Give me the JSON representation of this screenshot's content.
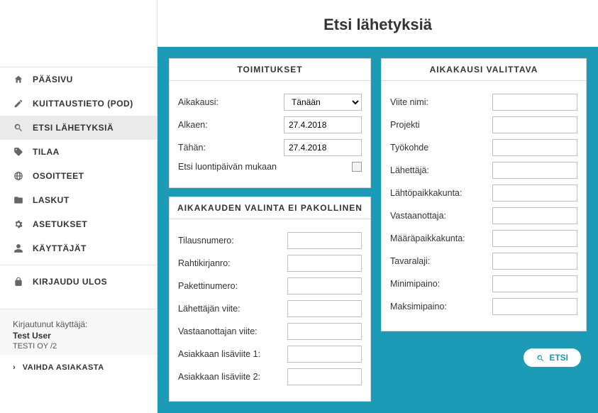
{
  "page": {
    "title": "Etsi lähetyksiä"
  },
  "nav": {
    "items": [
      {
        "label": "PÄÄSIVU",
        "icon": "home-icon"
      },
      {
        "label": "KUITTAUSTIETO (POD)",
        "icon": "pencil-icon"
      },
      {
        "label": "ETSI LÄHETYKSIÄ",
        "icon": "search-icon",
        "active": true
      },
      {
        "label": "TILAA",
        "icon": "tag-icon"
      },
      {
        "label": "OSOITTEET",
        "icon": "globe-icon"
      },
      {
        "label": "LASKUT",
        "icon": "folder-icon"
      },
      {
        "label": "ASETUKSET",
        "icon": "gear-icon"
      },
      {
        "label": "KÄYTTÄJÄT",
        "icon": "user-icon"
      }
    ],
    "logout": {
      "label": "KIRJAUDU ULOS",
      "icon": "lock-icon"
    }
  },
  "user": {
    "logged_in_label": "Kirjautunut käyttäjä:",
    "name": "Test User",
    "company": "TESTI OY /2",
    "change_customer": "VAIHDA ASIAKASTA"
  },
  "cards": {
    "toimitukset": {
      "header": "TOIMITUKSET",
      "aikakausi_label": "Aikakausi:",
      "aikakausi_value": "Tänään",
      "alkaen_label": "Alkaen:",
      "alkaen_value": "27.4.2018",
      "tahan_label": "Tähän:",
      "tahan_value": "27.4.2018",
      "luontipaiva_label": "Etsi luontipäivän mukaan"
    },
    "optional": {
      "header": "AIKAKAUDEN VALINTA EI PAKOLLINEN",
      "tilausnumero": "Tilausnumero:",
      "rahtikirjanro": "Rahtikirjanro:",
      "pakettinumero": "Pakettinumero:",
      "lahettajan_viite": "Lähettäjän viite:",
      "vastaanottajan_viite": "Vastaanottajan viite:",
      "lisaviite1": "Asiakkaan lisäviite 1:",
      "lisaviite2": "Asiakkaan lisäviite 2:"
    },
    "aikakausi": {
      "header": "AIKAKAUSI VALITTAVA",
      "viitenimi": "Viite nimi:",
      "projekti": "Projekti",
      "tyokohde": "Työkohde",
      "lahettaja": "Lähettäjä:",
      "lahtopaikka": "Lähtöpaikkakunta:",
      "vastaanottaja": "Vastaanottaja:",
      "maarapaikka": "Määräpaikkakunta:",
      "tavaralaji": "Tavaralaji:",
      "minimipaino": "Minimipaino:",
      "maksimipaino": "Maksimipaino:"
    }
  },
  "buttons": {
    "search": "ETSI"
  }
}
